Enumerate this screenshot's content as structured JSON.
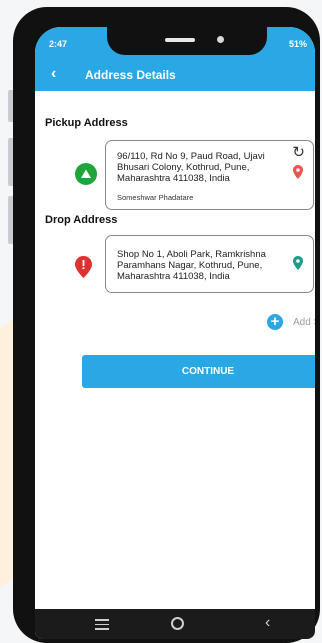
{
  "status_bar": {
    "time": "2:47",
    "indicators": "51%"
  },
  "app_bar": {
    "title": "Address Details",
    "back_icon": "back-arrow-icon"
  },
  "pickup": {
    "label": "Pickup Address",
    "address": "96/110, Rd No 9, Paud Road, Ujavi Bhusari Colony, Kothrud, Pune, Maharashtra 411038, India",
    "contact_name": "Someshwar Phadatare"
  },
  "drop": {
    "label": "Drop Address",
    "address": "Shop No 1, Aboli Park, Ramkrishna Paramhans Nagar, Kothrud, Pune, Maharashtra 411038, India"
  },
  "add_stop": {
    "label": "Add Stop"
  },
  "continue_button": {
    "label": "CONTINUE"
  },
  "colors": {
    "primary": "#2aa8e6",
    "pickup_green": "#1fa33b",
    "drop_red": "#e03131",
    "pin_red": "#ef5350",
    "pin_teal": "#1e9c8a"
  }
}
